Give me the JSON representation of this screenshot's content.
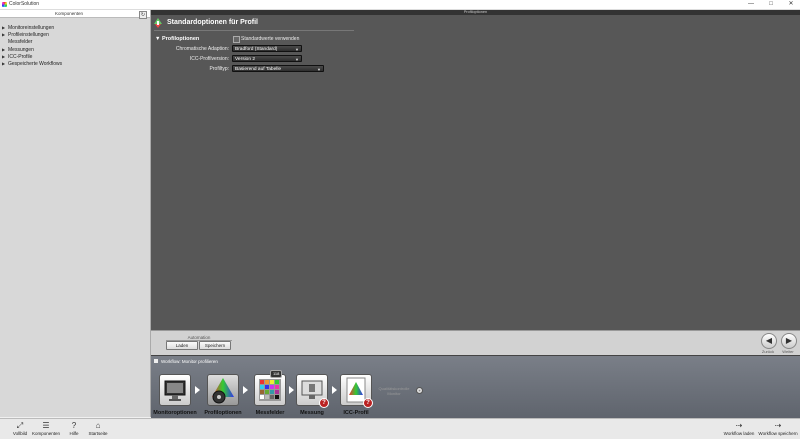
{
  "window": {
    "title": "ColorSolution",
    "minimize": "—",
    "maximize": "□",
    "close": "✕"
  },
  "left": {
    "header": "Komponenten",
    "items": [
      {
        "label": "Monitoreinstellungen",
        "expandable": true
      },
      {
        "label": "Profileinstellungen",
        "expandable": true
      },
      {
        "label": "Messfelder",
        "expandable": false
      },
      {
        "label": "Messungen",
        "expandable": true
      },
      {
        "label": "ICC-Profile",
        "expandable": true
      },
      {
        "label": "Gespeicherte Workflows",
        "expandable": true
      }
    ]
  },
  "main": {
    "panel_name": "Profiloptionen",
    "title": "Standardoptionen für Profil",
    "section": "▼ Profiloptionen",
    "use_defaults_label": "Standardwerte verwenden",
    "fields": [
      {
        "label": "Chromatische Adaption:",
        "value": "Bradford (Standard)"
      },
      {
        "label": "ICC-Profilversion:",
        "value": "Version 2"
      },
      {
        "label": "Profiltyp:",
        "value": "Basierend auf Tabelle"
      }
    ]
  },
  "bottom": {
    "automation_label": "Automation",
    "load": "Laden",
    "save": "Speichern",
    "back": "Zurück",
    "next": "Weiter"
  },
  "workflow": {
    "title": "Workflow: Monitor profilieren",
    "steps": [
      {
        "label": "Monitoroptionen"
      },
      {
        "label": "Profiloptionen"
      },
      {
        "label": "Messfelder",
        "badge": "118"
      },
      {
        "label": "Messung"
      },
      {
        "label": "ICC-Profil"
      }
    ],
    "quality": "Qualitätskontrolle\nMonitor"
  },
  "toolbar": {
    "fullscreen": "Vollbild",
    "components": "Komponenten",
    "help": "Hilfe",
    "home": "Startseite",
    "load_workflow": "Workflow laden",
    "save_workflow": "Workflow speichern"
  },
  "colors": {
    "main_bg": "#575757",
    "panel_bg": "#d8d8d8",
    "warn": "#b22222"
  }
}
